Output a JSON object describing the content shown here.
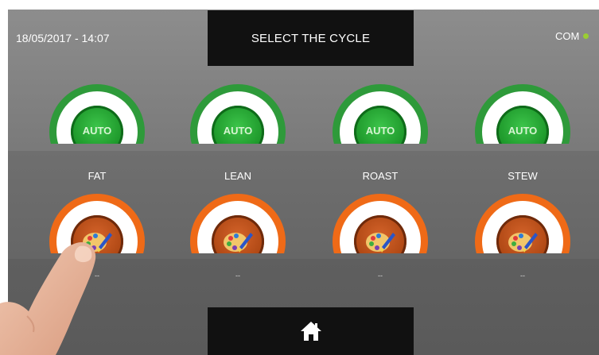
{
  "header": {
    "datetime": "18/05/2017 - 14:07",
    "title": "SELECT THE CYCLE",
    "com_label": "COM",
    "com_status_color": "#9acd32"
  },
  "auto_cycles": [
    {
      "badge": "AUTO",
      "label": "FAT"
    },
    {
      "badge": "AUTO",
      "label": "LEAN"
    },
    {
      "badge": "AUTO",
      "label": "ROAST"
    },
    {
      "badge": "AUTO",
      "label": "STEW"
    }
  ],
  "custom_cycles": [
    {
      "icon": "palette-brush-icon",
      "label": "--"
    },
    {
      "icon": "palette-brush-icon",
      "label": "--"
    },
    {
      "icon": "palette-brush-icon",
      "label": "--"
    },
    {
      "icon": "palette-brush-icon",
      "label": "--"
    }
  ],
  "footer": {
    "home_icon": "home-icon"
  },
  "colors": {
    "auto_ring": "#2e9a3a",
    "custom_ring": "#ef6a17",
    "panel_dark": "#111111"
  }
}
